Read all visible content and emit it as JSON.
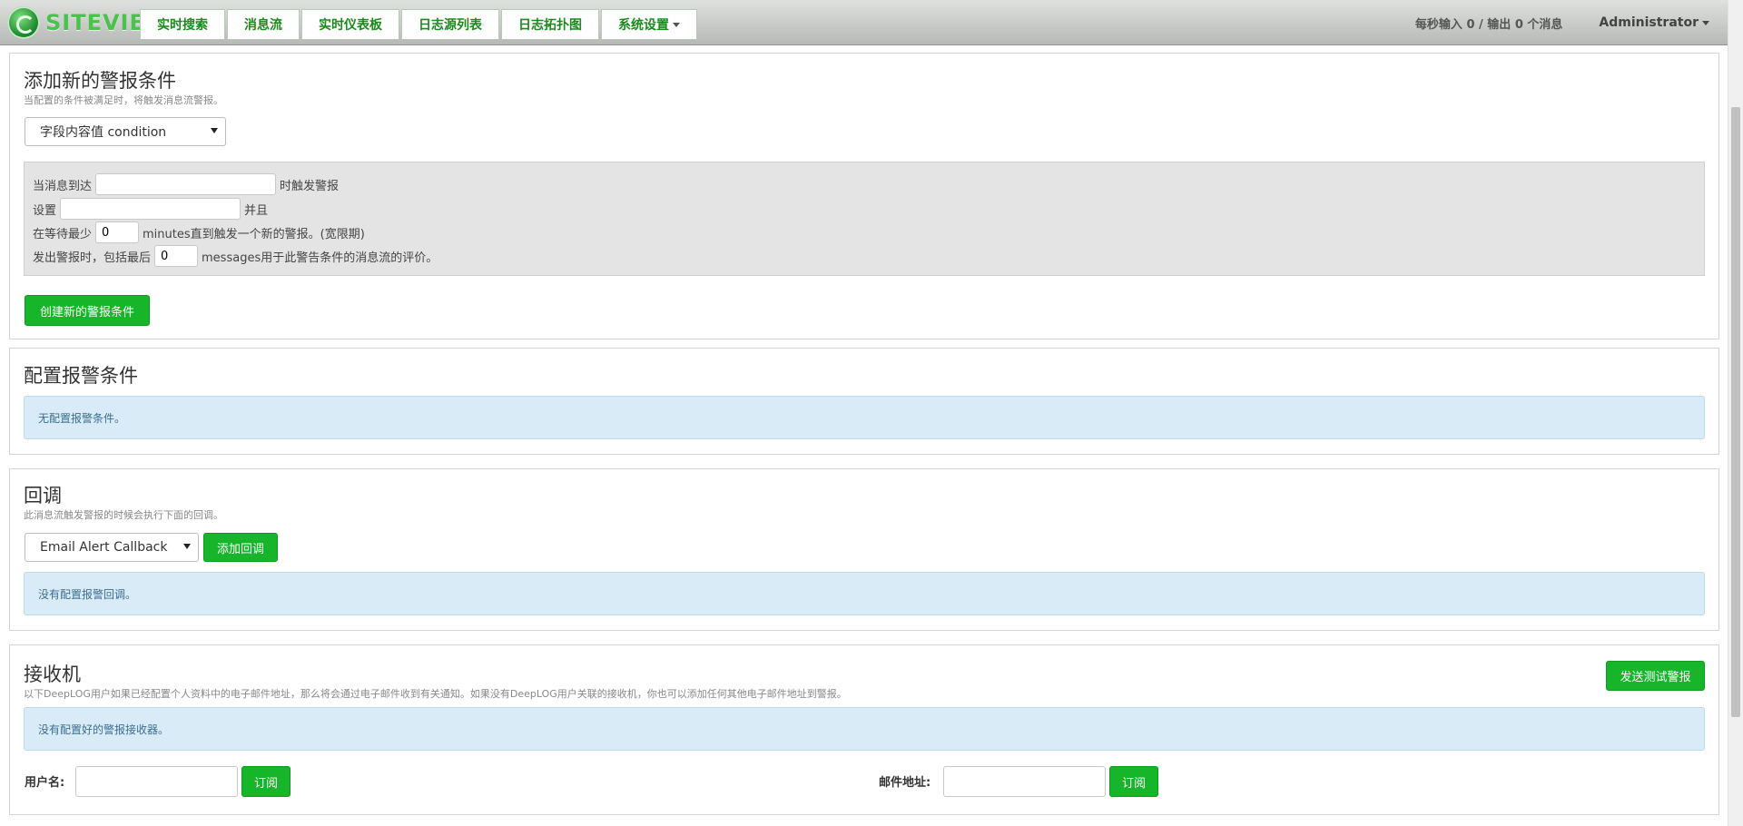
{
  "brand": {
    "name": "SITEVIEW"
  },
  "nav": {
    "items": [
      {
        "label": "实时搜索"
      },
      {
        "label": "消息流"
      },
      {
        "label": "实时仪表板"
      },
      {
        "label": "日志源列表"
      },
      {
        "label": "日志拓扑图"
      },
      {
        "label": "系统设置"
      }
    ],
    "throughput": "每秒输入 0 / 输出 0 个消息",
    "user": "Administrator"
  },
  "alert_conditions": {
    "title": "添加新的警报条件",
    "description": "当配置的条件被满足时，将触发消息流警报。",
    "condition_type": "字段内容值 condition",
    "row1_before": "当消息到达",
    "row1_after": "时触发警报",
    "row2_before": "设置",
    "row2_after": "并且",
    "row3_before": "在等待最少",
    "row3_value": "0",
    "row3_after": "minutes直到触发一个新的警报。(宽限期)",
    "row4_before": "发出警报时，包括最后",
    "row4_value": "0",
    "row4_after": "messages用于此警告条件的消息流的评价。",
    "create_button": "创建新的警报条件"
  },
  "configured_conditions": {
    "title": "配置报警条件",
    "empty_text": "无配置报警条件。"
  },
  "callbacks": {
    "title": "回调",
    "description": "此消息流触发警报的时候会执行下面的回调。",
    "callback_type": "Email Alert Callback",
    "add_button": "添加回调",
    "empty_text": "没有配置报警回调。"
  },
  "receivers": {
    "title": "接收机",
    "description": "以下DeepLOG用户如果已经配置个人资料中的电子邮件地址，那么将会通过电子邮件收到有关通知。如果没有DeepLOG用户关联的接收机，你也可以添加任何其他电子邮件地址到警报。",
    "send_test_button": "发送测试警报",
    "empty_text": "没有配置好的警报接收器。",
    "username_label": "用户名:",
    "email_label": "邮件地址:",
    "subscribe_label": "订阅"
  },
  "colors": {
    "accent": "#17b52a",
    "info_bg": "#d9ebf6"
  }
}
